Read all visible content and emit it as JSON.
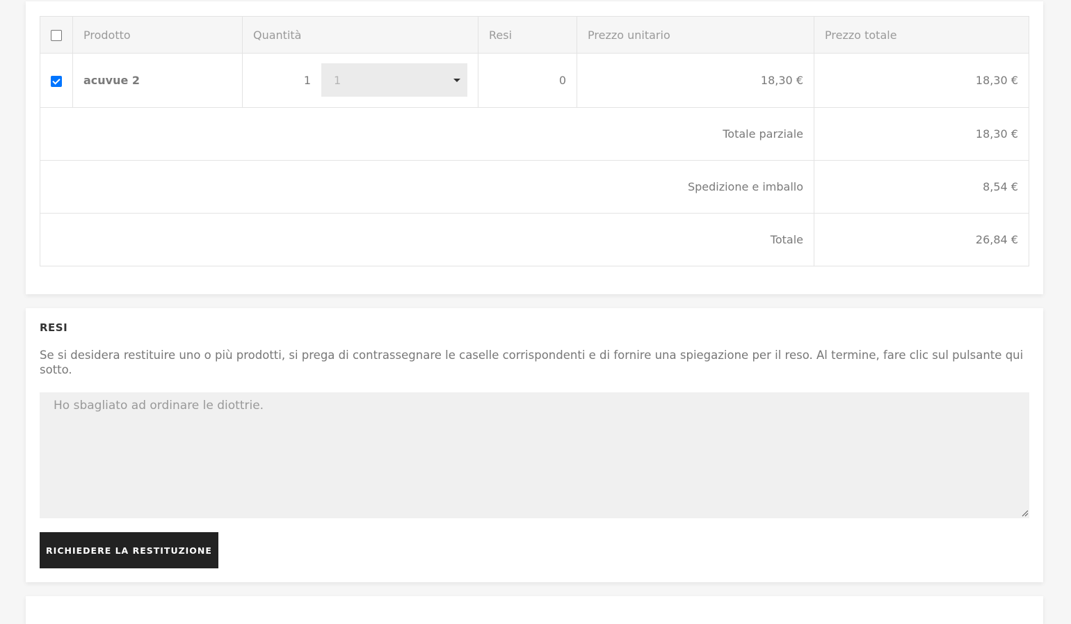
{
  "table": {
    "headers": {
      "product": "Prodotto",
      "quantity": "Quantità",
      "returns": "Resi",
      "unit_price": "Prezzo unitario",
      "total_price": "Prezzo totale"
    },
    "rows": [
      {
        "checked": true,
        "product": "acuvue 2",
        "quantity": "1",
        "quantity_select": "1",
        "returns": "0",
        "unit_price": "18,30 €",
        "total_price": "18,30 €"
      }
    ],
    "summary": [
      {
        "label": "Totale parziale",
        "value": "18,30 €"
      },
      {
        "label": "Spedizione e imballo",
        "value": "8,54 €"
      },
      {
        "label": "Totale",
        "value": "26,84 €"
      }
    ]
  },
  "returns": {
    "title": "RESI",
    "description": "Se si desidera restituire uno o più prodotti, si prega di contrassegnare le caselle corrispondenti e di fornire una spiegazione per il reso. Al termine, fare clic sul pulsante qui sotto.",
    "textarea_value": "Ho sbagliato ad ordinare le diottrie.",
    "submit_label": "RICHIEDERE LA RESTITUZIONE"
  },
  "colors": {
    "checkbox_checked": "#0075ff",
    "button_bg": "#222222"
  }
}
